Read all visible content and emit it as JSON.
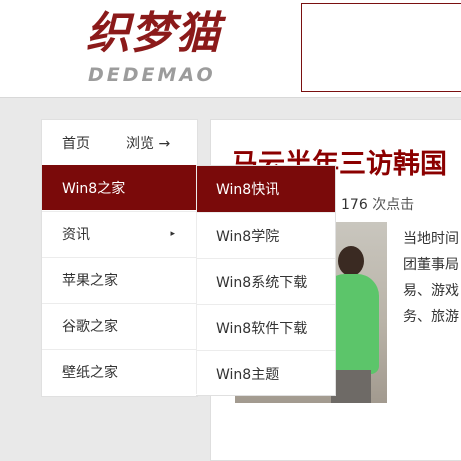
{
  "header": {
    "logo_cn": "织梦猫",
    "logo_en": "DEDEMAO"
  },
  "nav": {
    "home": "首页",
    "browse": "浏览 →"
  },
  "menu": {
    "items": [
      {
        "label": "Win8之家",
        "active": true
      },
      {
        "label": "资讯",
        "has_submenu": true
      },
      {
        "label": "苹果之家"
      },
      {
        "label": "谷歌之家"
      },
      {
        "label": "壁纸之家"
      }
    ]
  },
  "submenu": {
    "items": [
      {
        "label": "Win8快讯",
        "active": true
      },
      {
        "label": "Win8学院"
      },
      {
        "label": "Win8系统下载"
      },
      {
        "label": "Win8软件下载"
      },
      {
        "label": "Win8主题"
      }
    ]
  },
  "article": {
    "title": "马云半年三访韩国",
    "clicks_count": "176",
    "clicks_label": "次点击",
    "body_lines": [
      "当地时间",
      "团董事局",
      "易、游戏",
      "务、旅游"
    ]
  },
  "colors": {
    "brand": "#8b1a1a",
    "menu_active": "#7a0a0a",
    "title": "#8b0000"
  }
}
